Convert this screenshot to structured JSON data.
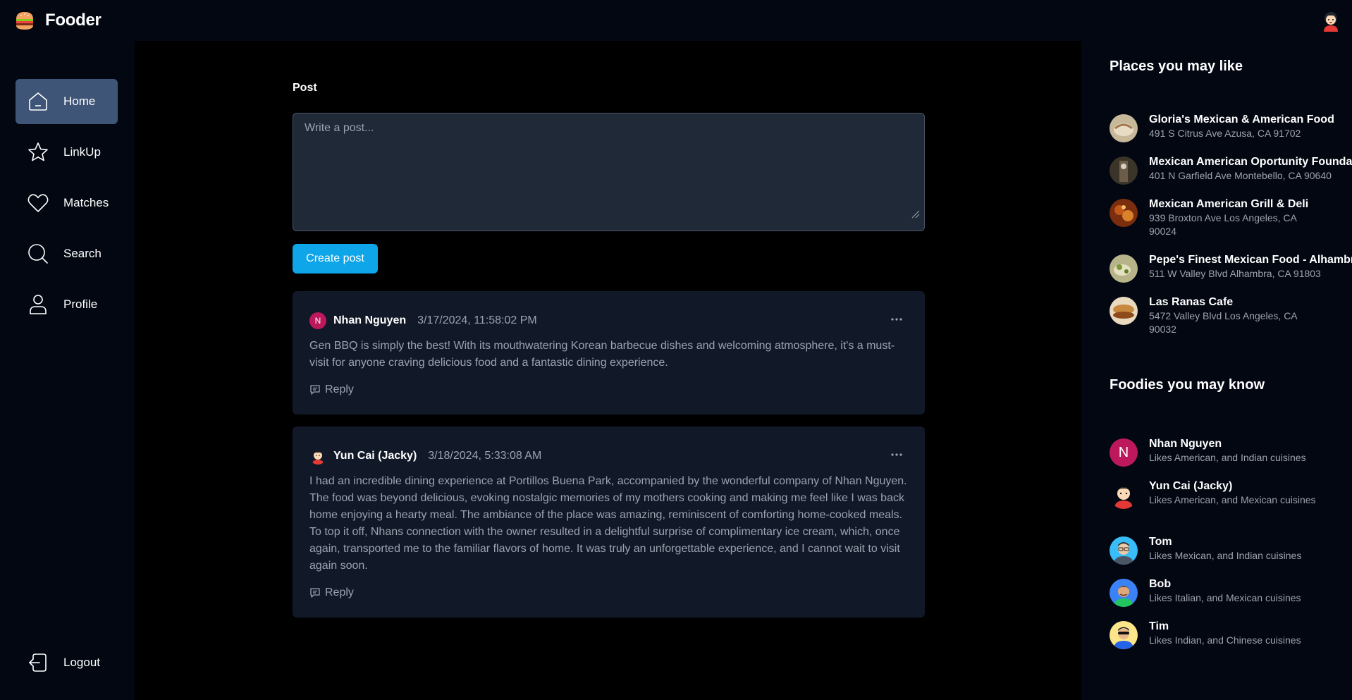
{
  "app": {
    "name": "Fooder"
  },
  "nav": {
    "items": [
      {
        "label": "Home",
        "active": true
      },
      {
        "label": "LinkUp"
      },
      {
        "label": "Matches"
      },
      {
        "label": "Search"
      },
      {
        "label": "Profile"
      }
    ],
    "logout": "Logout"
  },
  "composer": {
    "label": "Post",
    "placeholder": "Write a post...",
    "submit": "Create post"
  },
  "posts": [
    {
      "avatar_letter": "N",
      "author": "Nhan Nguyen",
      "date": "3/17/2024, 11:58:02 PM",
      "body": "Gen BBQ is simply the best! With its mouthwatering Korean barbecue dishes and welcoming atmosphere, it's a must-visit for anyone craving delicious food and a fantastic dining experience.",
      "reply": "Reply"
    },
    {
      "author": "Yun Cai (Jacky)",
      "date": "3/18/2024, 5:33:08 AM",
      "body": "I had an incredible dining experience at Portillos Buena Park, accompanied by the wonderful company of Nhan Nguyen. The food was beyond delicious, evoking nostalgic memories of my mothers cooking and making me feel like I was back home enjoying a hearty meal. The ambiance of the place was amazing, reminiscent of comforting home-cooked meals. To top it off, Nhans connection with the owner resulted in a delightful surprise of complimentary ice cream, which, once again, transported me to the familiar flavors of home. It was truly an unforgettable experience, and I cannot wait to visit again soon.",
      "reply": "Reply"
    }
  ],
  "places": {
    "title": "Places you may like",
    "items": [
      {
        "name": "Gloria's Mexican & American Food",
        "address": "491 S Citrus Ave Azusa, CA 91702"
      },
      {
        "name": "Mexican American Oportunity Founda",
        "address": "401 N Garfield Ave Montebello, CA 90640"
      },
      {
        "name": "Mexican American Grill & Deli",
        "address": "939 Broxton Ave Los Angeles, CA 90024"
      },
      {
        "name": "Pepe's Finest Mexican Food - Alhambr",
        "address": "511 W Valley Blvd Alhambra, CA 91803"
      },
      {
        "name": "Las Ranas Cafe",
        "address": "5472 Valley Blvd Los Angeles, CA 90032"
      }
    ]
  },
  "foodies": {
    "title": "Foodies you may know",
    "items": [
      {
        "name": "Nhan Nguyen",
        "likes": "Likes American, and Indian cuisines",
        "avatar_letter": "N"
      },
      {
        "name": "Yun Cai (Jacky)",
        "likes": "Likes American, and Mexican cuisines"
      },
      {
        "name": "Tom",
        "likes": "Likes Mexican, and Indian cuisines"
      },
      {
        "name": "Bob",
        "likes": "Likes Italian, and Mexican cuisines"
      },
      {
        "name": "Tim",
        "likes": "Likes Indian, and Chinese cuisines"
      }
    ]
  },
  "colors": {
    "background": "#000000",
    "panel": "#030712",
    "card": "#111827",
    "active_nav": "#3f5577",
    "accent": "#0ea5e9",
    "muted_text": "#9ca3af",
    "avatar_pink": "#be185d"
  },
  "icons": {
    "logo": "burger-icon",
    "nav": [
      "home-icon",
      "star-icon",
      "heart-icon",
      "search-icon",
      "user-icon"
    ],
    "logout": "logout-icon",
    "post_menu": "ellipsis-icon",
    "reply": "chat-bubble-icon"
  }
}
